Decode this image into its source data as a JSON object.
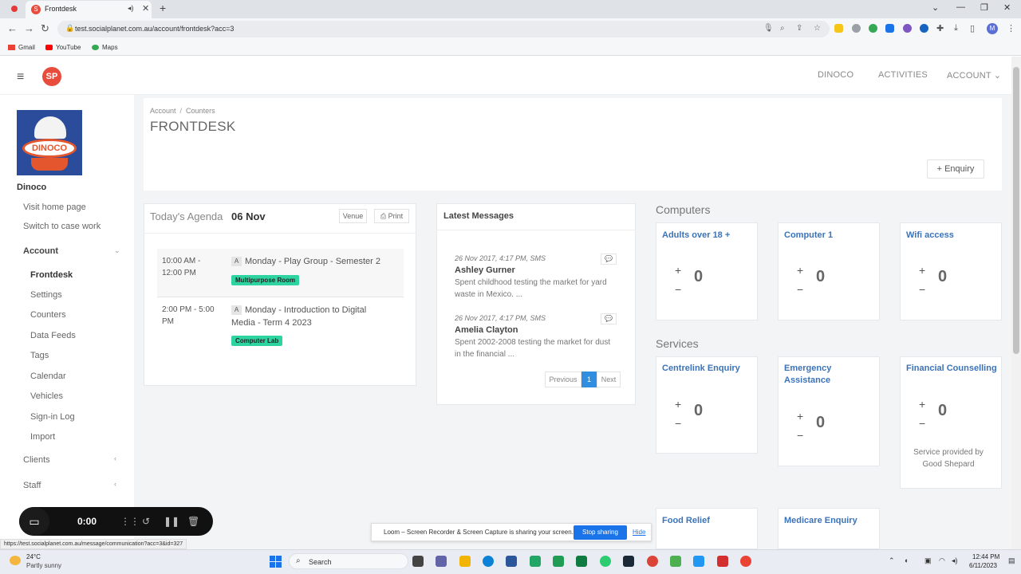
{
  "browser": {
    "tab_title": "Frontdesk",
    "url": "test.socialplanet.com.au/account/frontdesk?acc=3",
    "bookmarks": [
      "Gmail",
      "YouTube",
      "Maps"
    ],
    "profile_initial": "M"
  },
  "header": {
    "logo_text": "SP",
    "nav": [
      "DINOCO",
      "ACTIVITIES",
      "ACCOUNT"
    ]
  },
  "sidebar": {
    "org_logo_text": "DINOCO",
    "org_name": "Dinoco",
    "links": [
      "Visit home page",
      "Switch to case work"
    ],
    "account_heading": "Account",
    "account_items": [
      "Frontdesk",
      "Settings",
      "Counters",
      "Data Feeds",
      "Tags",
      "Calendar",
      "Vehicles",
      "Sign-in Log",
      "Import"
    ],
    "clients": "Clients",
    "staff": "Staff"
  },
  "breadcrumb": {
    "first": "Account",
    "second": "Counters"
  },
  "page_title": "FRONTDESK",
  "enquiry_label": "Enquiry",
  "agenda": {
    "label": "Today's Agenda",
    "date": "06 Nov",
    "venue_btn": "Venue",
    "print_btn": "Print",
    "items": [
      {
        "time": "10:00 AM -\n12:00 PM",
        "badge": "A",
        "title": "Monday - Play Group - Semester 2",
        "room": "Multipurpose Room"
      },
      {
        "time": "2:00 PM - 5:00\nPM",
        "badge": "A",
        "title": "Monday - Introduction to Digital Media - Term 4 2023",
        "room": "Computer Lab"
      }
    ]
  },
  "messages": {
    "heading": "Latest Messages",
    "items": [
      {
        "meta": "26 Nov 2017, 4:17 PM, SMS",
        "name": "Ashley Gurner",
        "body": "Spent childhood testing the market for yard waste in Mexico. ..."
      },
      {
        "meta": "26 Nov 2017, 4:17 PM, SMS",
        "name": "Amelia Clayton",
        "body": "Spent 2002-2008 testing the market for dust in the financial ..."
      }
    ],
    "pager": {
      "previous": "Previous",
      "page": "1",
      "next": "Next"
    }
  },
  "computers": {
    "heading": "Computers",
    "counters": [
      {
        "title": "Adults over 18 +",
        "value": "0"
      },
      {
        "title": "Computer 1",
        "value": "0"
      },
      {
        "title": "Wifi access",
        "value": "0"
      }
    ]
  },
  "services": {
    "heading": "Services",
    "counters": [
      {
        "title": "Centrelink Enquiry",
        "value": "0"
      },
      {
        "title": "Emergency Assistance",
        "value": "0"
      },
      {
        "title": "Financial Counselling",
        "value": "0",
        "note": "Service provided by Good Shepard"
      }
    ],
    "more": [
      "Food Relief",
      "Medicare Enquiry"
    ]
  },
  "loom": {
    "timer": "0:00",
    "share_text": "Loom – Screen Recorder & Screen Capture is sharing your screen.",
    "stop": "Stop sharing",
    "hide": "Hide"
  },
  "status_url": "https://test.socialplanet.com.au/message/communication?acc=3&id=327",
  "taskbar": {
    "temp": "24°C",
    "weather": "Partly sunny",
    "search": "Search",
    "time": "12:44 PM",
    "date": "6/11/2023"
  },
  "colors": {
    "accent": "#3b73b9",
    "room_tag": "#2dd4a0",
    "brand": "#e74c3c"
  }
}
